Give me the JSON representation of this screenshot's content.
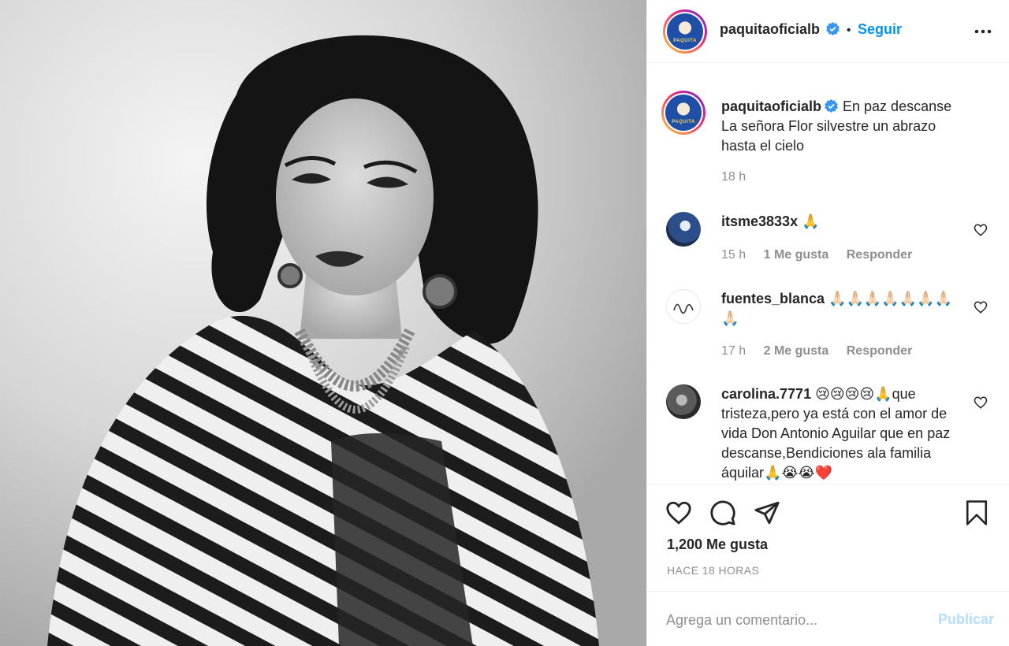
{
  "post": {
    "username": "paquitaoficialb",
    "follow_label": "Seguir",
    "separator": "•",
    "caption": "En paz descanse La señora Flor silvestre un abrazo hasta el cielo",
    "caption_time": "18 h",
    "likes": "1,200 Me gusta",
    "time_ago": "HACE 18 HORAS"
  },
  "comments": [
    {
      "username": "itsme3833x",
      "text": "🙏",
      "time": "15 h",
      "likes": "1 Me gusta",
      "reply_label": "Responder"
    },
    {
      "username": "fuentes_blanca",
      "text": "🙏🏻🙏🏻🙏🏻🙏🏻🙏🏻🙏🏻🙏🏻🙏🏻",
      "time": "17 h",
      "likes": "2 Me gusta",
      "reply_label": "Responder"
    },
    {
      "username": "carolina.7771",
      "text": "😢😢😢😢🙏que tristeza,pero ya está con el amor de vida Don Antonio Aguilar que en paz descanse,Bendiciones ala familia áquilar🙏😭😭❤️"
    }
  ],
  "add_comment": {
    "placeholder": "Agrega un comentario...",
    "publish_label": "Publicar"
  },
  "colors": {
    "accent": "#0095f6",
    "publish_disabled": "#b2dffc",
    "muted": "#8e8e8e",
    "text": "#262626"
  },
  "icons": {
    "verified": "verified-badge-icon",
    "more": "more-options-icon",
    "like": "heart-icon",
    "comment": "comment-bubble-icon",
    "share": "paper-plane-icon",
    "save": "bookmark-icon"
  }
}
